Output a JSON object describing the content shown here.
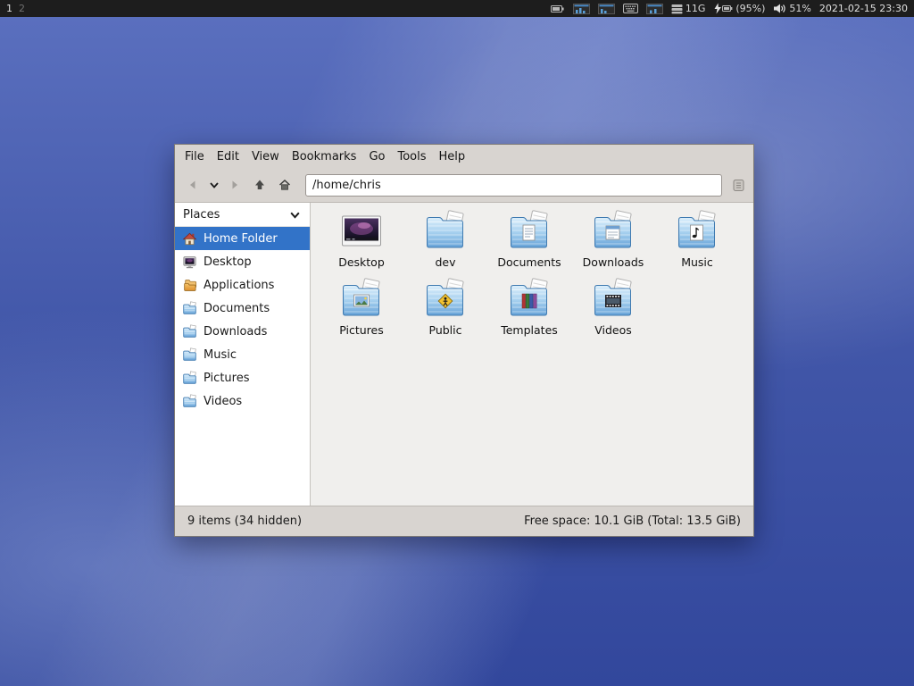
{
  "panel": {
    "workspace1": "1",
    "workspace2": "2",
    "disk_usage": "11G",
    "battery": "(95%)",
    "volume": "51%",
    "clock": "2021-02-15 23:30"
  },
  "window": {
    "menubar": [
      "File",
      "Edit",
      "View",
      "Bookmarks",
      "Go",
      "Tools",
      "Help"
    ],
    "toolbar": {
      "path": "/home/chris",
      "icons": [
        "back-icon",
        "chevron-down-icon",
        "forward-icon",
        "up-icon",
        "home-icon",
        "scroll-icon"
      ]
    },
    "sidebar": {
      "header": "Places",
      "header_icon": "chevron-down-icon",
      "items": [
        {
          "label": "Home Folder",
          "icon": "home-folder-icon",
          "selected": true
        },
        {
          "label": "Desktop",
          "icon": "desktop-icon",
          "selected": false
        },
        {
          "label": "Applications",
          "icon": "applications-icon",
          "selected": false
        },
        {
          "label": "Documents",
          "icon": "folder-icon",
          "selected": false
        },
        {
          "label": "Downloads",
          "icon": "folder-icon",
          "selected": false
        },
        {
          "label": "Music",
          "icon": "folder-icon",
          "selected": false
        },
        {
          "label": "Pictures",
          "icon": "folder-icon",
          "selected": false
        },
        {
          "label": "Videos",
          "icon": "folder-icon",
          "selected": false
        }
      ]
    },
    "files": [
      {
        "label": "Desktop",
        "icon": "desktop-preview-icon"
      },
      {
        "label": "dev",
        "icon": "folder-icon"
      },
      {
        "label": "Documents",
        "icon": "folder-documents-icon"
      },
      {
        "label": "Downloads",
        "icon": "folder-downloads-icon"
      },
      {
        "label": "Music",
        "icon": "folder-music-icon"
      },
      {
        "label": "Pictures",
        "icon": "folder-pictures-icon"
      },
      {
        "label": "Public",
        "icon": "folder-public-icon"
      },
      {
        "label": "Templates",
        "icon": "folder-templates-icon"
      },
      {
        "label": "Videos",
        "icon": "folder-videos-icon"
      }
    ],
    "statusbar": {
      "items": "9 items (34 hidden)",
      "free_space": "Free space: 10.1 GiB (Total: 13.5 GiB)"
    }
  },
  "colors": {
    "selection_blue": "#3273c8",
    "panel_bg": "#1d1d1d",
    "folder_blue": "#8fc0e8",
    "desktop_blue": "#4156a8"
  }
}
